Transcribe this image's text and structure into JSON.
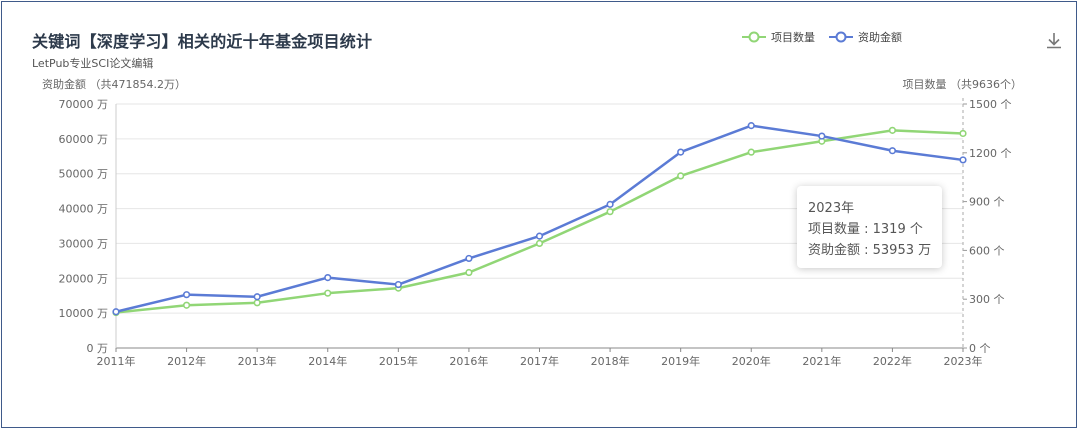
{
  "header": {
    "title": "关键词【深度学习】相关的近十年基金项目统计",
    "subtitle": "LetPub专业SCI论文编辑",
    "left_axis_title": "资助金额 （共471854.2万）",
    "right_axis_title": "项目数量 （共9636个）"
  },
  "legend": [
    {
      "name": "项目数量",
      "color": "#91d676"
    },
    {
      "name": "资助金额",
      "color": "#5b7bd5"
    }
  ],
  "icons": {
    "download": "download-icon"
  },
  "tooltip": {
    "year": "2023年",
    "line1": "项目数量 : 1319 个",
    "line2": "资助金额 : 53953 万"
  },
  "chart_data": {
    "type": "line",
    "title": "关键词【深度学习】相关的近十年基金项目统计",
    "categories": [
      "2011年",
      "2012年",
      "2013年",
      "2014年",
      "2015年",
      "2016年",
      "2017年",
      "2018年",
      "2019年",
      "2020年",
      "2021年",
      "2022年",
      "2023年"
    ],
    "series": [
      {
        "name": "项目数量",
        "axis": "right",
        "color": "#91d676",
        "values": [
          218,
          263,
          278,
          337,
          368,
          464,
          643,
          838,
          1058,
          1204,
          1271,
          1338,
          1319
        ]
      },
      {
        "name": "资助金额",
        "axis": "left",
        "color": "#5b7bd5",
        "values": [
          10400,
          15300,
          14700,
          20200,
          18200,
          25700,
          32100,
          41200,
          56200,
          63800,
          60800,
          56600,
          53953
        ]
      }
    ],
    "y_left": {
      "label": "资助金额",
      "range": [
        0,
        70000
      ],
      "ticks": [
        0,
        10000,
        20000,
        30000,
        40000,
        50000,
        60000,
        70000
      ],
      "unit": "万"
    },
    "y_right": {
      "label": "项目数量",
      "range": [
        0,
        1500
      ],
      "ticks": [
        0,
        300,
        600,
        900,
        1200,
        1500
      ],
      "unit": "个"
    },
    "grid": true,
    "legend_position": "top-right",
    "highlight_category": "2023年"
  }
}
